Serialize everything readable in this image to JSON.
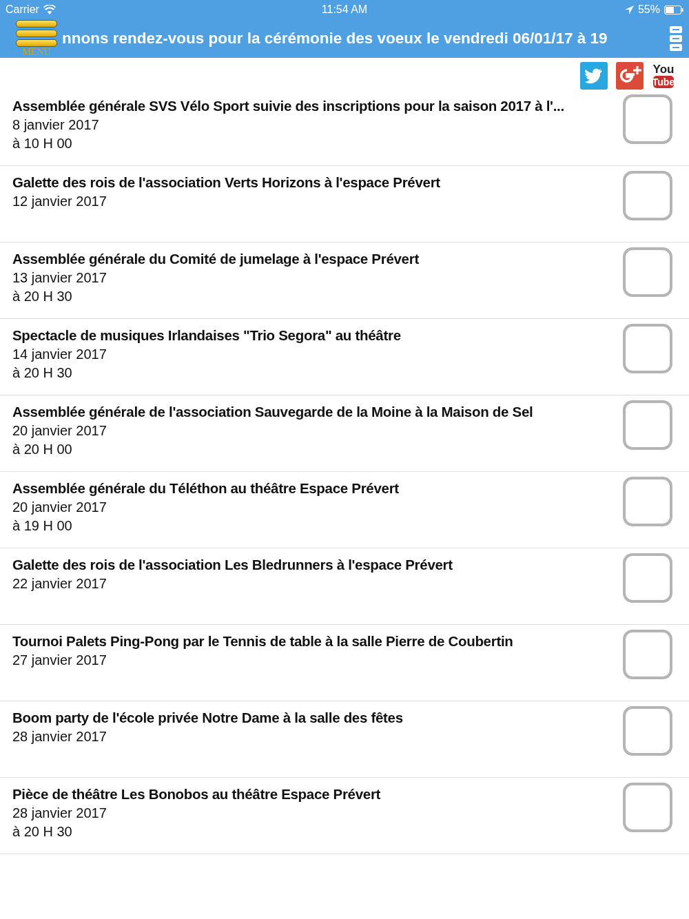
{
  "status_bar": {
    "carrier": "Carrier",
    "time": "11:54 AM",
    "battery": "55%"
  },
  "header": {
    "menu_label": "MENU",
    "marquee": "nnons rendez-vous pour la cérémonie des voeux le vendredi 06/01/17 à 19"
  },
  "social": {
    "youtube_top": "You",
    "youtube_bottom": "Tube"
  },
  "events": [
    {
      "title": "Assemblée générale SVS Vélo Sport suivie des inscriptions pour la saison 2017 à l'...",
      "date": "8 janvier 2017",
      "time": "à 10 H 00",
      "checked": false
    },
    {
      "title": "Galette des rois de l'association Verts Horizons à l'espace Prévert",
      "date": "12 janvier 2017",
      "checked": false
    },
    {
      "title": "Assemblée générale du Comité de jumelage à l'espace Prévert",
      "date": "13 janvier 2017",
      "time": "à 20 H 30",
      "checked": false
    },
    {
      "title": "Spectacle de musiques Irlandaises \"Trio Segora\" au théâtre",
      "date": "14 janvier 2017",
      "time": "à 20 H 30",
      "checked": false
    },
    {
      "title": "Assemblée générale de l'association Sauvegarde de la Moine à la Maison de Sel",
      "date": "20 janvier 2017",
      "time": "à 20 H 00",
      "checked": false
    },
    {
      "title": "Assemblée générale du Téléthon au théâtre Espace Prévert",
      "date": "20 janvier 2017",
      "time": "à 19 H 00",
      "checked": false
    },
    {
      "title": "Galette des rois de l'association Les Bledrunners à l'espace Prévert",
      "date": "22 janvier 2017",
      "checked": false
    },
    {
      "title": "Tournoi Palets Ping-Pong par le Tennis de table à la salle Pierre de Coubertin",
      "date": "27 janvier 2017",
      "checked": false
    },
    {
      "title": "Boom party de l'école privée Notre Dame à la salle des fêtes",
      "date": "28 janvier 2017",
      "checked": false
    },
    {
      "title": "Pièce de théâtre Les Bonobos au théâtre Espace Prévert",
      "date": "28 janvier 2017",
      "time": "à 20 H 30",
      "checked": false
    }
  ]
}
